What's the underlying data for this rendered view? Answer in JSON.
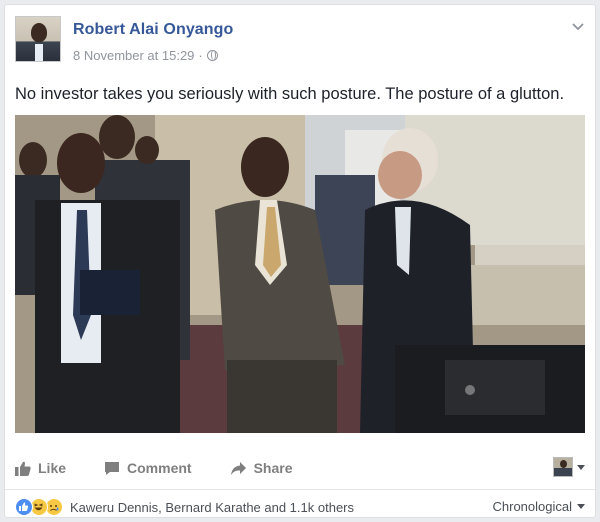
{
  "post": {
    "author": "Robert Alai Onyango",
    "timestamp": "8 November at 15:29",
    "separator": "·",
    "privacy_icon": "globe-icon",
    "text": "No investor takes you seriously with such posture. The posture of a glutton."
  },
  "actions": {
    "like_label": "Like",
    "comment_label": "Comment",
    "share_label": "Share"
  },
  "reactions": {
    "icons": [
      "like-reaction-icon",
      "haha-reaction-icon",
      "sad-reaction-icon"
    ],
    "summary": "Kaweru Dennis, Bernard Karathe and 1.1k others"
  },
  "comments": {
    "order_label": "Chronological"
  },
  "colors": {
    "author_link": "#365899",
    "meta_text": "#90949c",
    "action_text": "#7f7f7f",
    "like_blue": "#4c8ef3"
  }
}
